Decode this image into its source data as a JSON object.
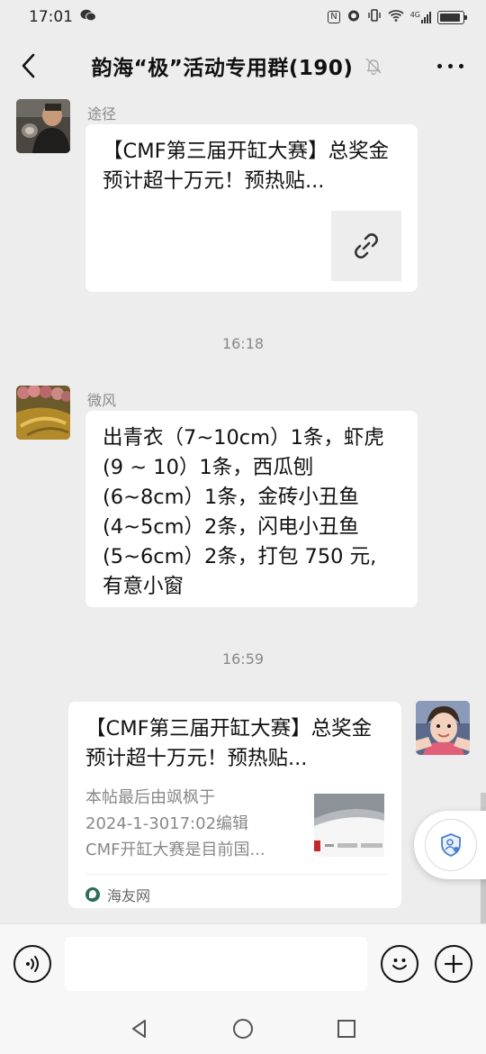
{
  "status_bar": {
    "time": "17:01",
    "signal_label": "4G"
  },
  "header": {
    "title": "韵海“极”活动专用群(190)"
  },
  "messages": [
    {
      "sender": "途径",
      "title": "【CMF第三届开缸大赛】总奖金预计超十万元！预热贴..."
    },
    {
      "time": "16:18"
    },
    {
      "sender": "微风",
      "lines": [
        "出青衣（7~10cm）1条，虾虎",
        "(9 ~ 10）1条，西瓜刨",
        "(6~8cm）1条，金砖小丑鱼",
        "(4~5cm）2条，闪电小丑鱼",
        "(5~6cm）2条，打包 750 元,",
        "有意小窗"
      ]
    },
    {
      "time": "16:59"
    },
    {
      "title": "【CMF第三届开缸大赛】总奖金预计超十万元！预热贴...",
      "desc_lines": [
        "本帖最后由飒枫于",
        "2024-1-3017:02编辑",
        "CMF开缸大赛是目前国..."
      ],
      "source": "海友网"
    }
  ],
  "icons": {
    "back": "chevron-left-icon",
    "mute": "bell-off-icon",
    "more": "more-icon",
    "link": "link-icon",
    "voice": "voice-icon",
    "emoji": "emoji-icon",
    "add": "plus-icon"
  },
  "colors": {
    "background": "#ededed",
    "bubble": "#ffffff",
    "muted_text": "#888888"
  }
}
